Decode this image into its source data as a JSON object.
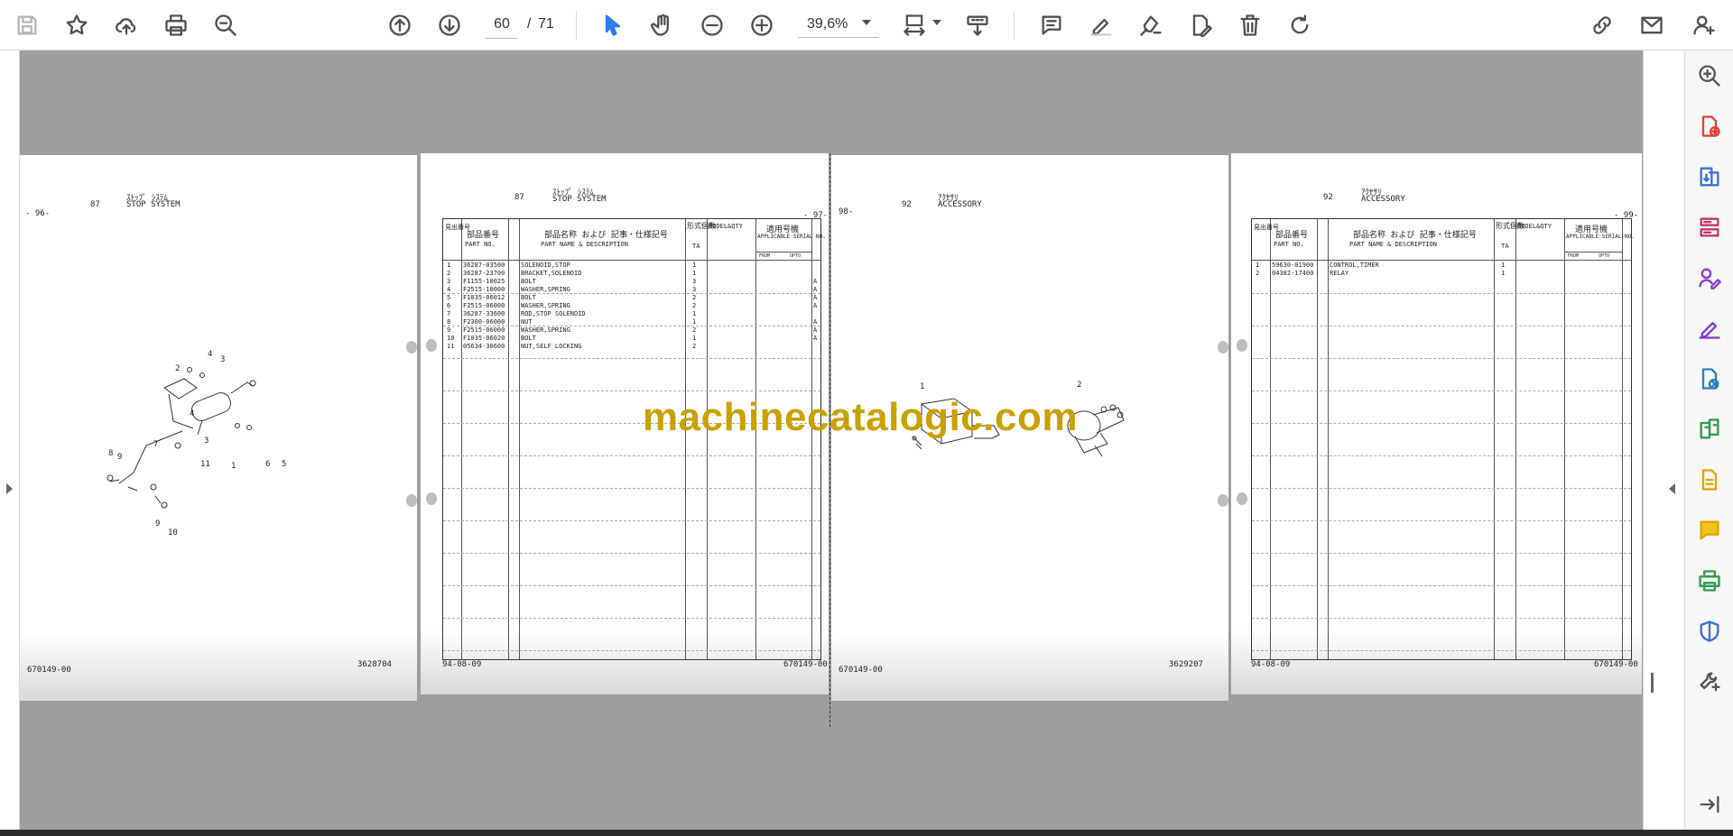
{
  "toolbar": {
    "page_current": "60",
    "page_separator": "/",
    "page_total": "71",
    "zoom": "39,6%"
  },
  "document": {
    "watermark": "machinecatalogic.com",
    "pages": [
      {
        "id": "p96",
        "page_number": "- 96-",
        "ref": "87",
        "title_jp": "ｽﾄｯﾌﾟ ｼｽﾃﾑ",
        "title": "STOP SYSTEM",
        "footer_left": "670149-00",
        "footer_right": "3628704",
        "callouts": [
          "2",
          "4",
          "3",
          "4",
          "8",
          "9",
          "7",
          "3",
          "11",
          "1",
          "6",
          "5",
          "9",
          "10"
        ]
      },
      {
        "id": "p97",
        "page_number": "- 97-",
        "ref": "87",
        "title_jp": "ｽﾄｯﾌﾟ ｼｽﾃﾑ",
        "title": "STOP SYSTEM",
        "footer_left": "94-08-09",
        "footer_right": "670149-00",
        "headers": {
          "ref_jp": "見出番号",
          "part_no_jp": "部品番号",
          "part_no": "PART NO.",
          "desc_jp": "部品名称 および 記事・仕様記号",
          "desc": "PART NAME & DESCRIPTION",
          "type_jp": "形式個数",
          "model": "MODEL&QTY",
          "type_code": "TA",
          "serial_jp": "適用号機",
          "serial": "APPLICABLE SERIAL NO.",
          "from": "FROM",
          "upto": "UPTO"
        },
        "rows": [
          {
            "ref": "1",
            "part": "36287-03500",
            "desc": "SOLENOID,STOP",
            "qty": "1",
            "mark": ""
          },
          {
            "ref": "2",
            "part": "36287-23700",
            "desc": "BRACKET,SOLENOID",
            "qty": "1",
            "mark": ""
          },
          {
            "ref": "3",
            "part": "F1155-10025",
            "desc": "BOLT",
            "qty": "3",
            "mark": "A"
          },
          {
            "ref": "4",
            "part": "F2515-10000",
            "desc": "WASHER,SPRING",
            "qty": "3",
            "mark": "A"
          },
          {
            "ref": "5",
            "part": "F1035-06012",
            "desc": "BOLT",
            "qty": "2",
            "mark": "A"
          },
          {
            "ref": "6",
            "part": "F2515-06000",
            "desc": "WASHER,SPRING",
            "qty": "2",
            "mark": "A"
          },
          {
            "ref": "7",
            "part": "36287-33600",
            "desc": "ROD,STOP SOLENOID",
            "qty": "1",
            "mark": ""
          },
          {
            "ref": "8",
            "part": "F2300-06000",
            "desc": "NUT",
            "qty": "1",
            "mark": "A"
          },
          {
            "ref": "9",
            "part": "F2515-06000",
            "desc": "WASHER,SPRING",
            "qty": "2",
            "mark": "A"
          },
          {
            "ref": "10",
            "part": "F1035-06020",
            "desc": "BOLT",
            "qty": "1",
            "mark": "A"
          },
          {
            "ref": "11",
            "part": "05634-30600",
            "desc": "NUT,SELF LOCKING",
            "qty": "2",
            "mark": ""
          }
        ]
      },
      {
        "id": "p98",
        "page_number": "98-",
        "ref": "92",
        "title_jp": "ｱｸｾｻﾘ",
        "title": "ACCESSORY",
        "footer_left": "670149-00",
        "footer_right": "3629207",
        "callouts": [
          "1",
          "2"
        ]
      },
      {
        "id": "p99",
        "page_number": "- 99-",
        "ref": "92",
        "title_jp": "ｱｸｾｻﾘ",
        "title": "ACCESSORY",
        "footer_left": "94-08-09",
        "footer_right": "670149-00",
        "headers": {
          "ref_jp": "見出番号",
          "part_no_jp": "部品番号",
          "part_no": "PART NO.",
          "desc_jp": "部品名称 および 記事・仕様記号",
          "desc": "PART NAME & DESCRIPTION",
          "type_jp": "形式個数",
          "model": "MODEL&QTY",
          "type_code": "TA",
          "serial_jp": "適用号機",
          "serial": "APPLICABLE SERIAL NO.",
          "from": "FROM",
          "upto": "UPTO"
        },
        "rows": [
          {
            "ref": "1",
            "part": "59630-01900",
            "desc": "CONTROL,TIMER",
            "qty": "1",
            "mark": ""
          },
          {
            "ref": "2",
            "part": "04382-17400",
            "desc": "RELAY",
            "qty": "1",
            "mark": ""
          }
        ]
      }
    ]
  }
}
